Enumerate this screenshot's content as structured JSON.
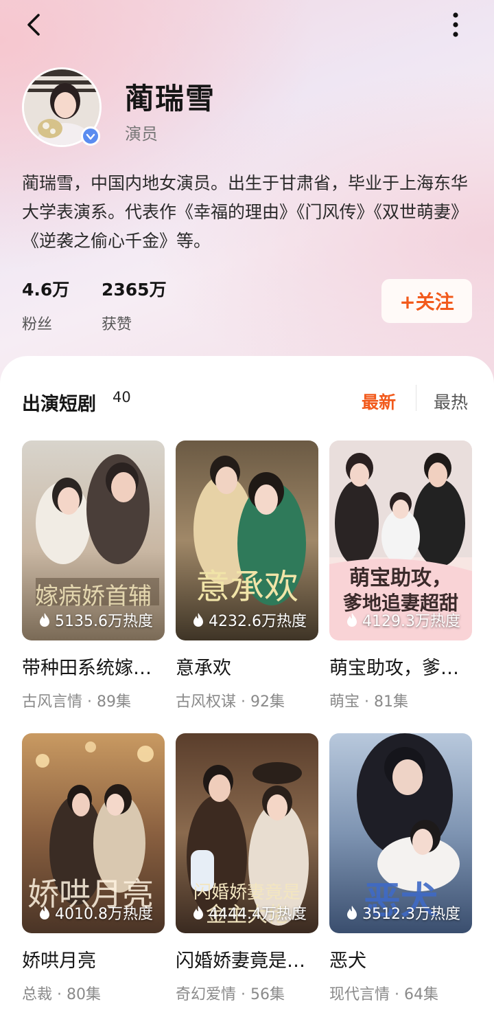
{
  "profile": {
    "name": "蔺瑞雪",
    "role": "演员",
    "bio": "蔺瑞雪，中国内地女演员。出生于甘肃省，毕业于上海东华大学表演系。代表作《幸福的理由》《门风传》《双世萌妻》《逆袭之偷心千金》等。",
    "followers_value": "4.6万",
    "followers_label": "粉丝",
    "likes_value": "2365万",
    "likes_label": "获赞",
    "follow_label": "+关注"
  },
  "section": {
    "title": "出演短剧",
    "count": "40",
    "sort_newest": "最新",
    "sort_hot": "最热"
  },
  "dramas": [
    {
      "title": "带种田系统嫁…",
      "heat": "5135.6万热度",
      "genre": "古风言情",
      "episodes": "89集",
      "meta": "古风言情 · 89集"
    },
    {
      "title": "意承欢",
      "heat": "4232.6万热度",
      "genre": "古风权谋",
      "episodes": "92集",
      "meta": "古风权谋 · 92集"
    },
    {
      "title": "萌宝助攻，爹…",
      "heat": "4129.3万热度",
      "genre": "萌宝",
      "episodes": "81集",
      "meta": "萌宝 · 81集"
    },
    {
      "title": "娇哄月亮",
      "heat": "4010.8万热度",
      "genre": "总裁",
      "episodes": "80集",
      "meta": "总裁 · 80集"
    },
    {
      "title": "闪婚娇妻竟是…",
      "heat": "4444.4万热度",
      "genre": "奇幻爱情",
      "episodes": "56集",
      "meta": "奇幻爱情 · 56集"
    },
    {
      "title": "恶犬",
      "heat": "3512.3万热度",
      "genre": "现代言情",
      "episodes": "64集",
      "meta": "现代言情 · 64集"
    }
  ],
  "colors": {
    "accent": "#f25a1c",
    "verify_badge": "#5a8cf0"
  },
  "icons": {
    "back": "chevron-left-icon",
    "more": "more-vertical-icon",
    "verified": "verified-badge-icon",
    "heat": "flame-icon"
  }
}
